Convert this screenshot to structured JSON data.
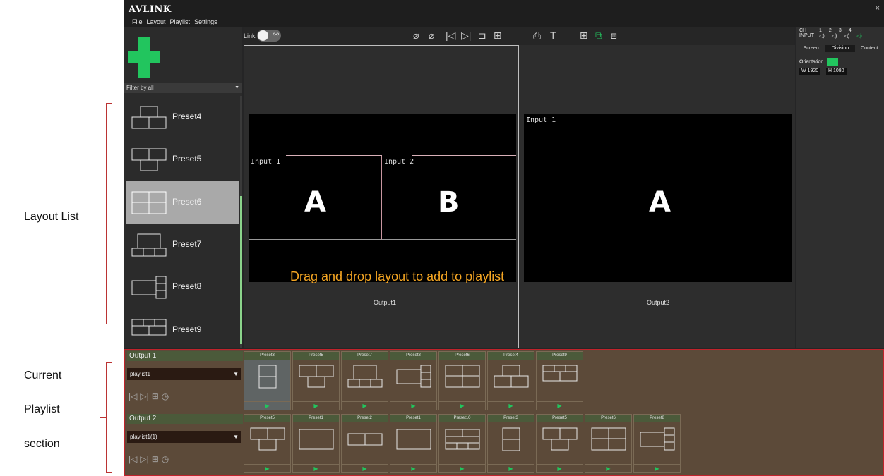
{
  "annotations": {
    "layout_list": "Layout List",
    "current_playlist_lines": [
      "Current",
      "Playlist",
      "section"
    ]
  },
  "app": {
    "logo": "AVLINK",
    "menu": [
      "File",
      "Layout",
      "Playlist",
      "Settings"
    ],
    "close": "×"
  },
  "left_panel": {
    "filter": "Filter by all",
    "presets": [
      {
        "name": "Preset4",
        "layout": "preset4"
      },
      {
        "name": "Preset5",
        "layout": "preset5"
      },
      {
        "name": "Preset6",
        "layout": "preset6",
        "selected": true
      },
      {
        "name": "Preset7",
        "layout": "preset7"
      },
      {
        "name": "Preset8",
        "layout": "preset8"
      },
      {
        "name": "Preset9",
        "layout": "preset9"
      }
    ]
  },
  "toolbar": {
    "link_label": "Link"
  },
  "canvas": {
    "output1": {
      "label": "Output1",
      "windows": [
        {
          "input": "Input 1",
          "letter": "A"
        },
        {
          "input": "Input 2",
          "letter": "B"
        }
      ]
    },
    "output2": {
      "label": "Output2",
      "windows": [
        {
          "input": "Input 1",
          "letter": "A"
        }
      ]
    },
    "hint": "Drag and drop layout to add to playlist"
  },
  "right_panel": {
    "ch_label": "CH",
    "input_label": "INPUT",
    "channels": [
      "1",
      "2",
      "3",
      "4"
    ],
    "tabs": [
      "Screen",
      "Division",
      "Content"
    ],
    "active_tab": "Division",
    "orientation_label": "Orientation",
    "width": "W 1920",
    "height": "H 1080"
  },
  "playlist": {
    "rows": [
      {
        "title": "Output 1",
        "playlist_name": "playlist1",
        "items": [
          "Preset3",
          "Preset5",
          "Preset7",
          "Preset8",
          "Preset6",
          "Preset4",
          "Preset9"
        ]
      },
      {
        "title": "Output 2",
        "playlist_name": "playlist1(1)",
        "items": [
          "Preset5",
          "Preset1",
          "Preset2",
          "Preset1",
          "Preset10",
          "Preset3",
          "Preset5",
          "Preset6",
          "Preset8"
        ]
      }
    ]
  }
}
